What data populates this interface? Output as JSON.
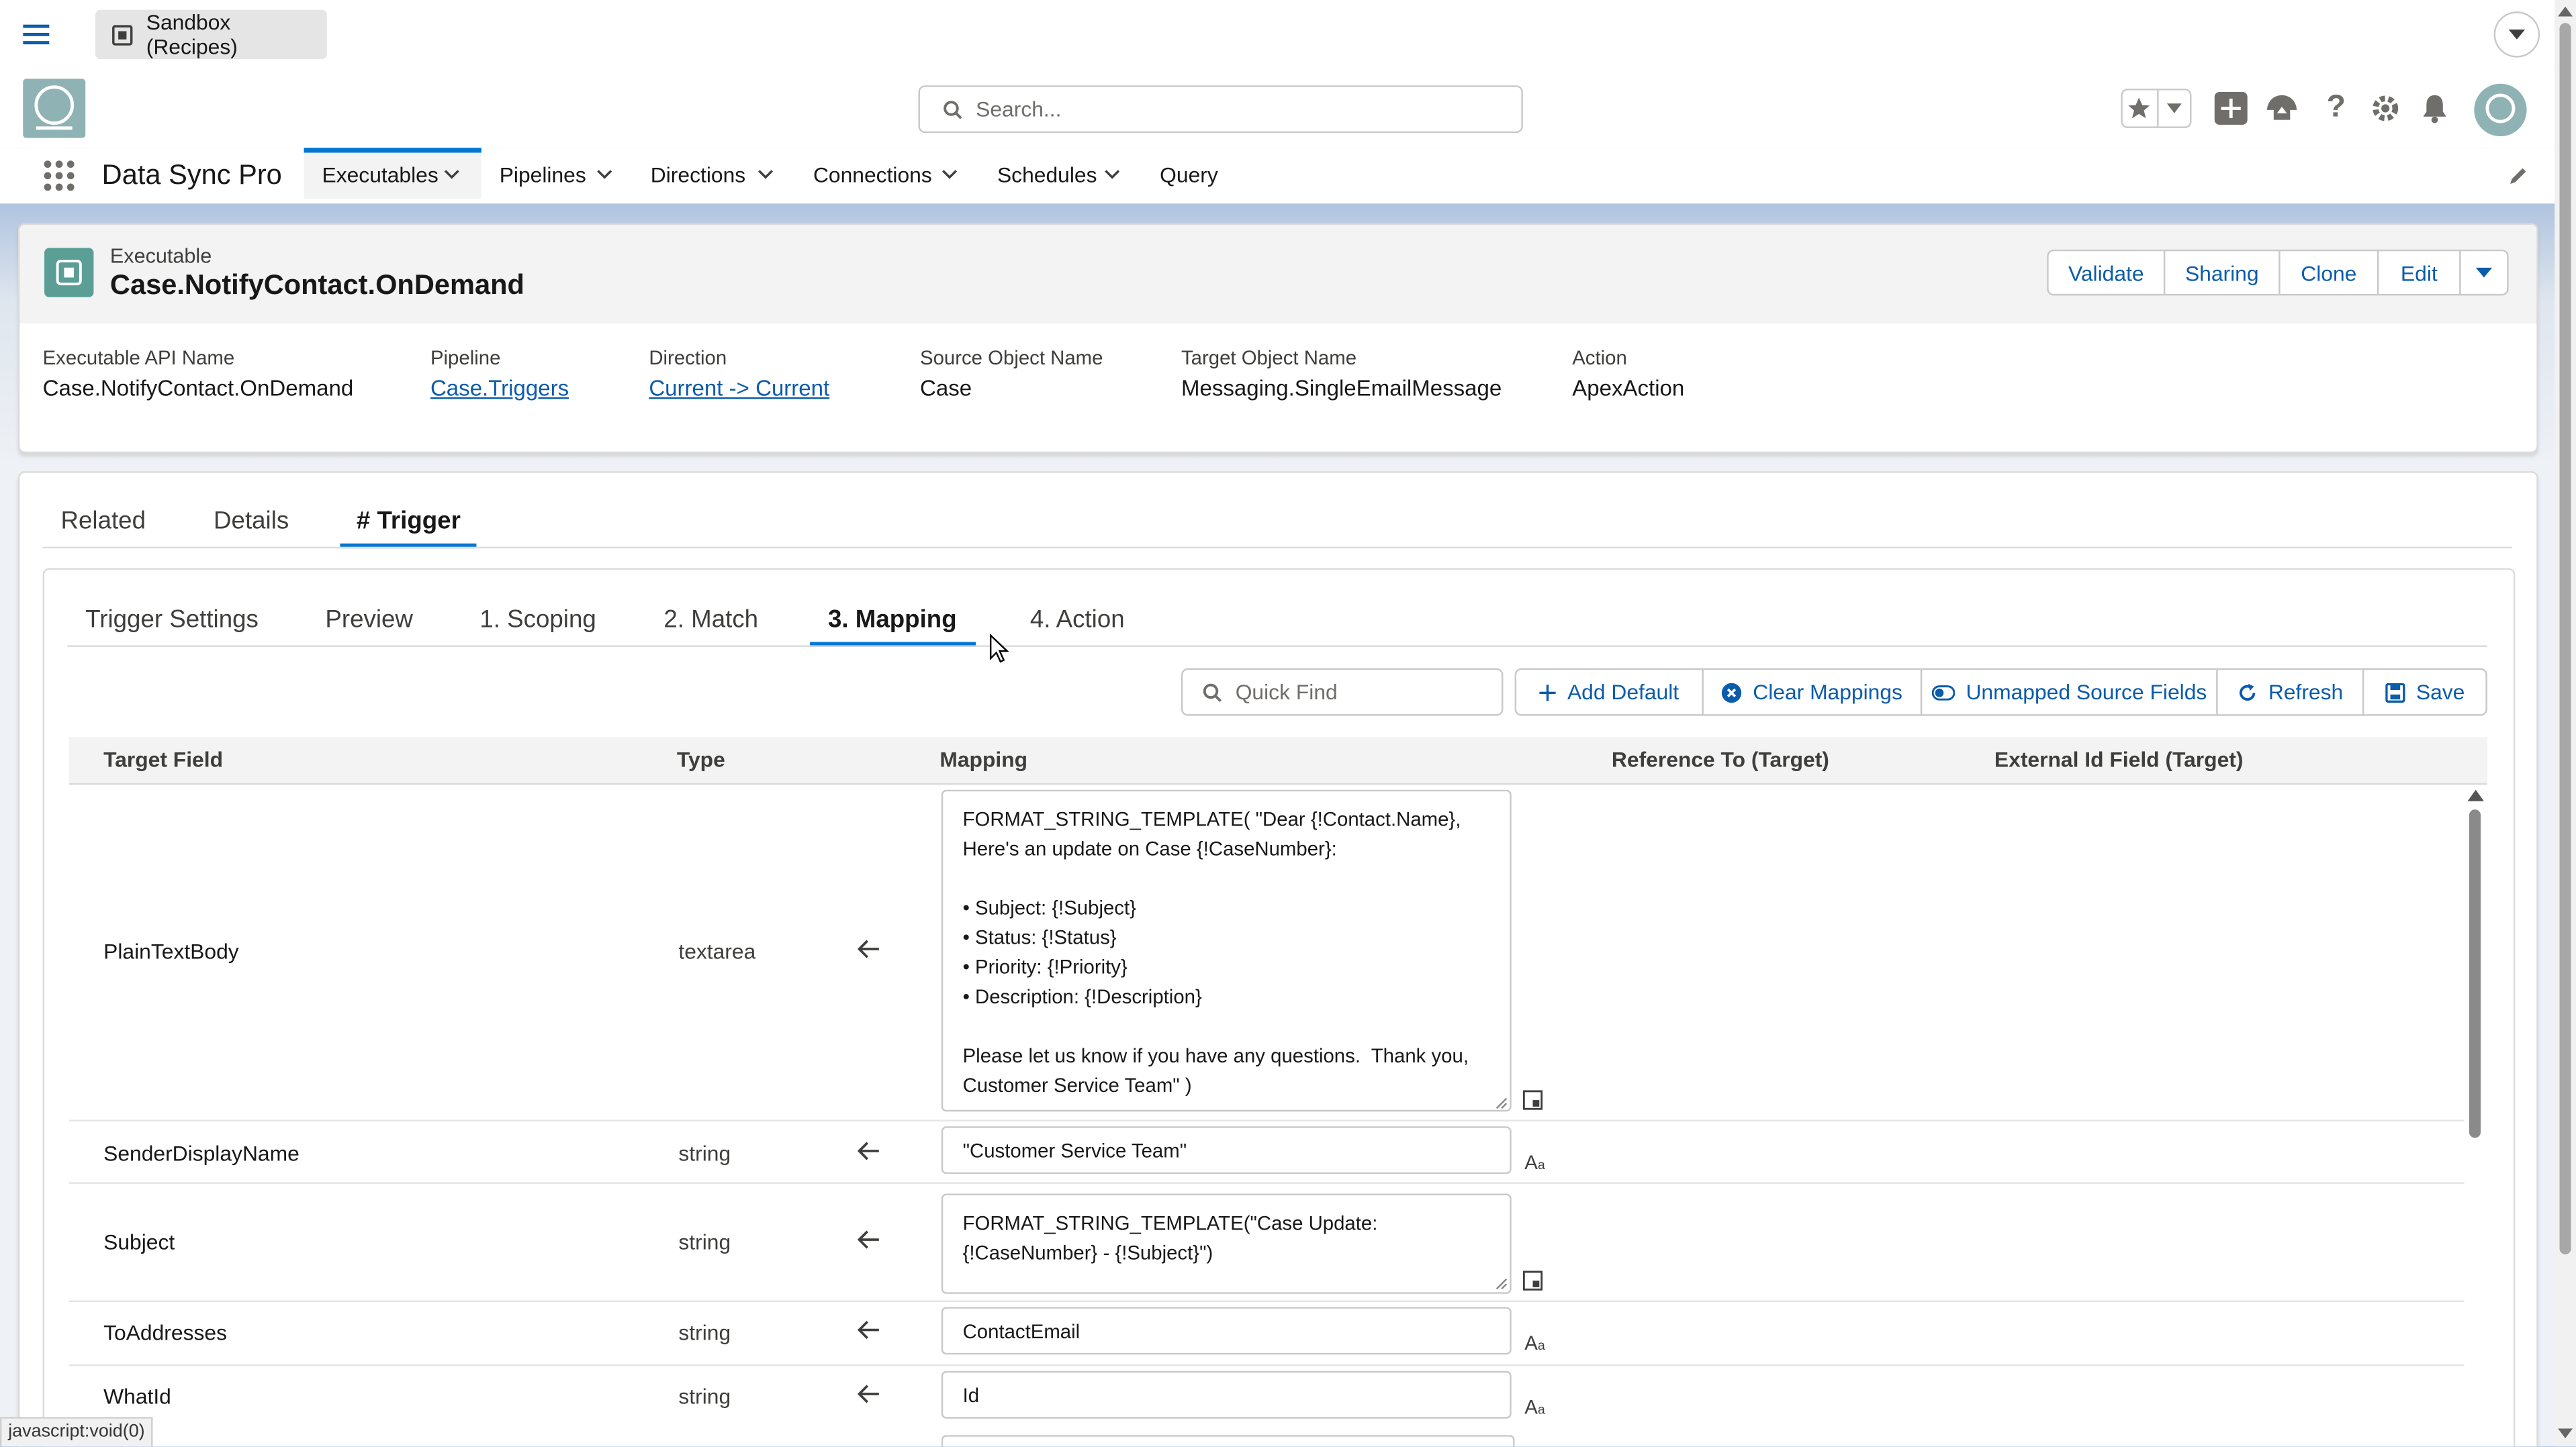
{
  "sysbar": {
    "org_name": "Sandbox (Recipes)"
  },
  "header": {
    "search_placeholder": "Search..."
  },
  "appnav": {
    "app_name": "Data Sync Pro",
    "tabs": [
      {
        "label": "Executables"
      },
      {
        "label": "Pipelines"
      },
      {
        "label": "Directions"
      },
      {
        "label": "Connections"
      },
      {
        "label": "Schedules"
      },
      {
        "label": "Query"
      }
    ]
  },
  "record": {
    "object_label": "Executable",
    "title": "Case.NotifyContact.OnDemand",
    "actions": [
      "Validate",
      "Sharing",
      "Clone",
      "Edit"
    ],
    "fields": [
      {
        "label": "Executable API Name",
        "value": "Case.NotifyContact.OnDemand"
      },
      {
        "label": "Pipeline",
        "value": "Case.Triggers"
      },
      {
        "label": "Direction",
        "value": "Current -> Current"
      },
      {
        "label": "Source Object Name",
        "value": "Case"
      },
      {
        "label": "Target Object Name",
        "value": "Messaging.SingleEmailMessage"
      },
      {
        "label": "Action",
        "value": "ApexAction"
      }
    ]
  },
  "record_tabs": [
    "Related",
    "Details",
    "# Trigger"
  ],
  "subtabs": [
    "Trigger Settings",
    "Preview",
    "1. Scoping",
    "2. Match",
    "3. Mapping",
    "4. Action"
  ],
  "toolbar": {
    "quickfind_placeholder": "Quick Find",
    "add_default": "Add Default",
    "clear_mappings": "Clear Mappings",
    "unmapped": "Unmapped Source Fields",
    "refresh": "Refresh",
    "save": "Save"
  },
  "table": {
    "headers": [
      "Target Field",
      "Type",
      "Mapping",
      "Reference To (Target)",
      "External Id Field (Target)"
    ],
    "rows": [
      {
        "field": "PlainTextBody",
        "type": "textarea",
        "mapping": "FORMAT_STRING_TEMPLATE( \"Dear {!Contact.Name},  Here's an update on Case {!CaseNumber}:\n\n• Subject: {!Subject}\n• Status: {!Status}\n• Priority: {!Priority}\n• Description: {!Description}\n\nPlease let us know if you have any questions.  Thank you,\nCustomer Service Team\" )"
      },
      {
        "field": "SenderDisplayName",
        "type": "string",
        "mapping": "\"Customer Service Team\""
      },
      {
        "field": "Subject",
        "type": "string",
        "mapping": "FORMAT_STRING_TEMPLATE(\"Case Update: {!CaseNumber} - {!Subject}\")"
      },
      {
        "field": "ToAddresses",
        "type": "string",
        "mapping": "ContactEmail"
      },
      {
        "field": "WhatId",
        "type": "string",
        "mapping": "Id"
      }
    ]
  },
  "status_bar": "javascript:void(0)"
}
